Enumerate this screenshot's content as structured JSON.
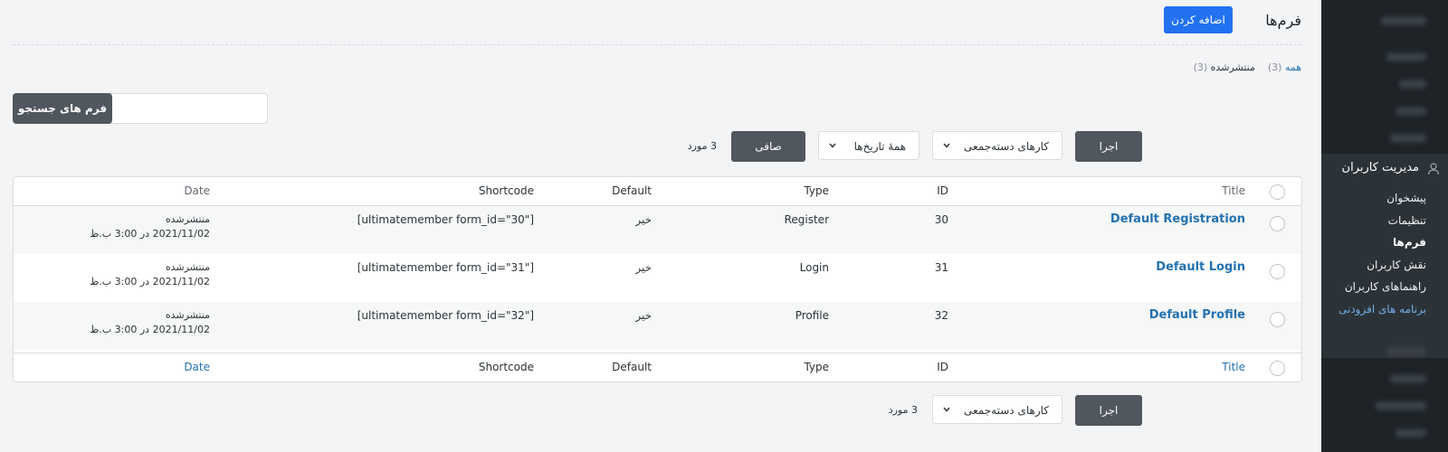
{
  "header": {
    "title": "فرم‌ها",
    "add_button": "اضافه کردن"
  },
  "views": {
    "all_label": "همه",
    "all_count": "(3)",
    "published_label": "منتشرشده",
    "published_count": "(3)"
  },
  "search": {
    "button": "فرم های جستجو",
    "placeholder": ""
  },
  "toolbar_top": {
    "apply": "اجرا",
    "bulk_actions": "کارهای دسته‌جمعی",
    "all_dates": "همهٔ تاریخ‌ها",
    "filter": "صافی",
    "items": "3 مورد"
  },
  "toolbar_bottom": {
    "apply": "اجرا",
    "bulk_actions": "کارهای دسته‌جمعی",
    "items": "3 مورد"
  },
  "table": {
    "columns": {
      "title": "Title",
      "id": "ID",
      "type": "Type",
      "default": "Default",
      "shortcode": "Shortcode",
      "date": "Date"
    },
    "rows": [
      {
        "title": "Default Registration",
        "id": "30",
        "type": "Register",
        "default": "خیر",
        "shortcode": "[ultimatemember form_id=\"30\"]",
        "status": "منتشرشده",
        "date": "2021/11/02 در 3:00 ب.ظ"
      },
      {
        "title": "Default Login",
        "id": "31",
        "type": "Login",
        "default": "خیر",
        "shortcode": "[ultimatemember form_id=\"31\"]",
        "status": "منتشرشده",
        "date": "2021/11/02 در 3:00 ب.ظ"
      },
      {
        "title": "Default Profile",
        "id": "32",
        "type": "Profile",
        "default": "خیر",
        "shortcode": "[ultimatemember form_id=\"32\"]",
        "status": "منتشرشده",
        "date": "2021/11/02 در 3:00 ب.ظ"
      }
    ]
  },
  "sidebar": {
    "current": "مدیریت کاربران",
    "submenu": [
      {
        "label": "پیشخوان"
      },
      {
        "label": "تنظیمات"
      },
      {
        "label": "فرم‌ها"
      },
      {
        "label": "نقش کاربران"
      },
      {
        "label": "راهنماهای کاربران"
      },
      {
        "label": "برنامه های افزودنی"
      }
    ]
  }
}
